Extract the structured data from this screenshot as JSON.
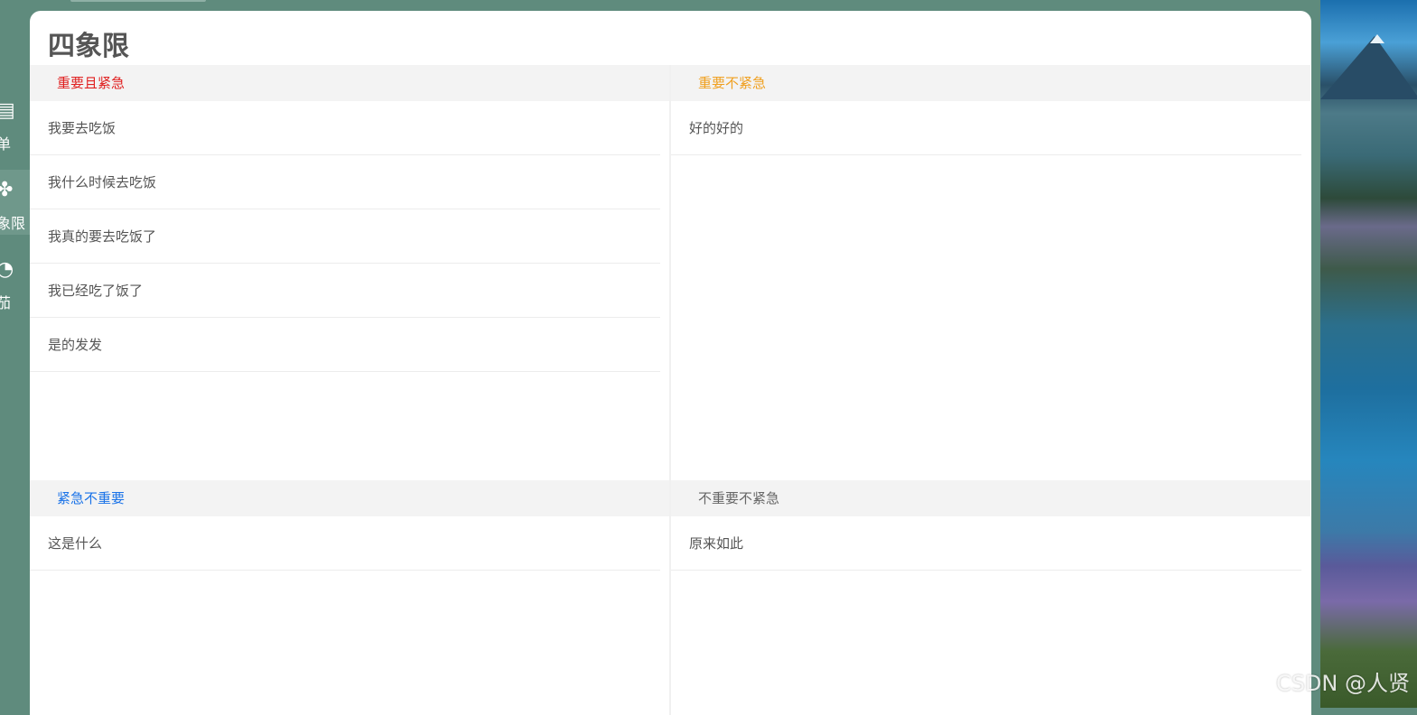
{
  "sidebar": {
    "items": [
      {
        "label": "单",
        "icon": "calendar-icon",
        "active": false
      },
      {
        "label": "象限",
        "icon": "quadrant-icon",
        "active": true
      },
      {
        "label": "茄",
        "icon": "tomato-timer-icon",
        "active": false
      }
    ]
  },
  "page": {
    "title": "四象限"
  },
  "quadrants": [
    {
      "title": "重要且紧急",
      "color": "#e02020",
      "items": [
        "我要去吃饭",
        "我什么时候去吃饭",
        "我真的要去吃饭了",
        "我已经吃了饭了",
        "是的发发"
      ]
    },
    {
      "title": "重要不紧急",
      "color": "#f0a020",
      "items": [
        "好的好的"
      ]
    },
    {
      "title": "紧急不重要",
      "color": "#1a73e8",
      "items": [
        "这是什么"
      ]
    },
    {
      "title": "不重要不紧急",
      "color": "#666666",
      "items": [
        "原来如此"
      ]
    }
  ],
  "watermark": "CSDN @人贤"
}
